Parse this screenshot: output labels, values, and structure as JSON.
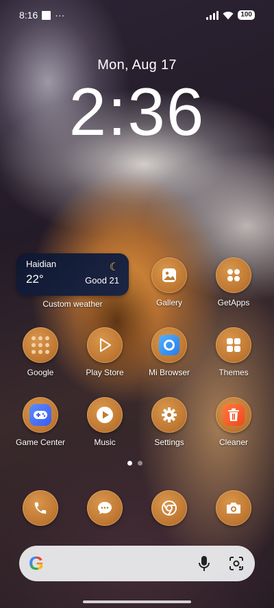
{
  "status": {
    "time": "8:16",
    "battery": "100"
  },
  "lock": {
    "date": "Mon, Aug 17",
    "clock": "2:36"
  },
  "weather": {
    "city": "Haidian",
    "temp": "22°",
    "aqi": "Good 21",
    "label": "Custom weather"
  },
  "apps": {
    "gallery": "Gallery",
    "getapps": "GetApps",
    "google": "Google",
    "playstore": "Play Store",
    "mibrowser": "Mi Browser",
    "themes": "Themes",
    "gamecenter": "Game Center",
    "music": "Music",
    "settings": "Settings",
    "cleaner": "Cleaner"
  },
  "dock": [
    "phone-icon",
    "messages-icon",
    "chrome-icon",
    "camera-icon"
  ],
  "search": {
    "logo": "G"
  },
  "colors": {
    "icon_bg": "#c17a34",
    "weather_bg": "#0f1730"
  }
}
